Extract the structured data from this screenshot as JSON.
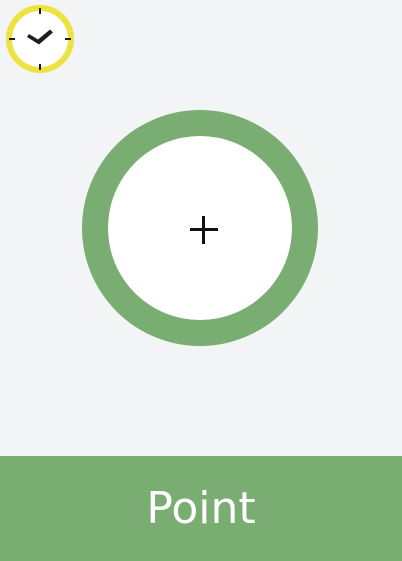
{
  "timer": {
    "icon": "clock-icon",
    "ring_color": "#ece33f",
    "hand_color": "#1d1d1d"
  },
  "target": {
    "icon": "crosshair-icon",
    "ring_color": "#79ad71",
    "center_color": "#ffffff"
  },
  "action_button": {
    "label": "Point",
    "background": "#79ad71"
  },
  "colors": {
    "background": "#f3f4f6",
    "text_on_button": "#ffffff"
  }
}
